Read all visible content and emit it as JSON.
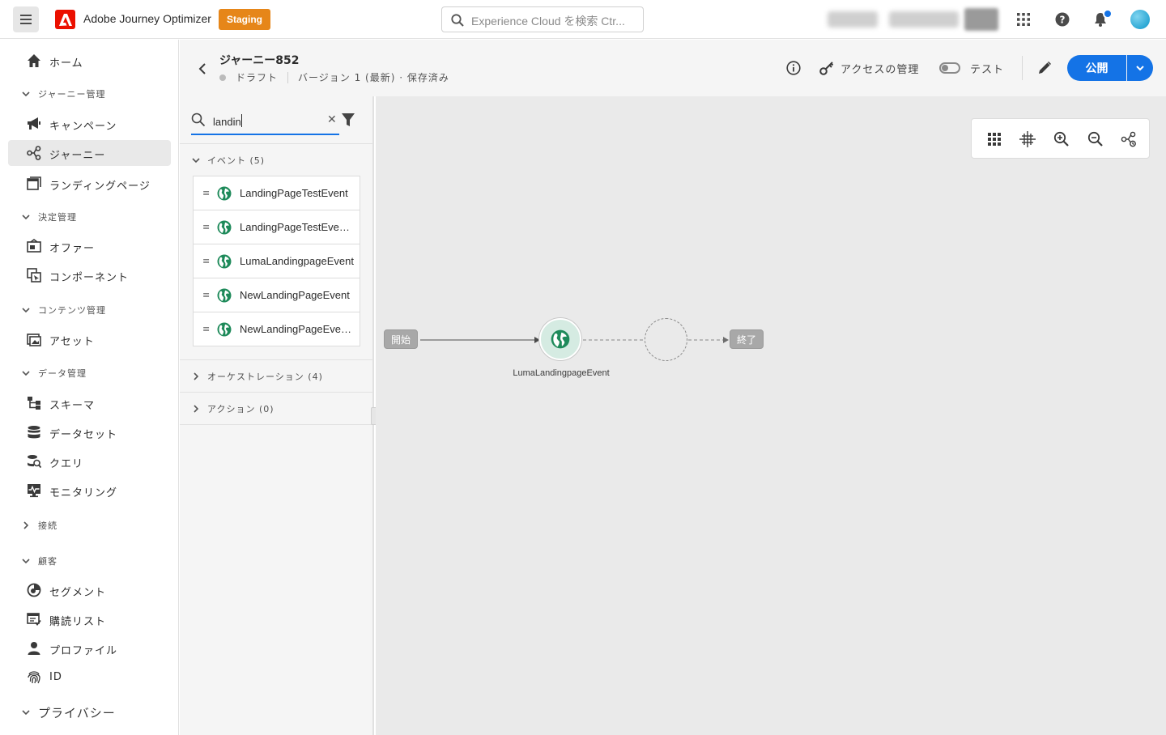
{
  "topbar": {
    "app_name": "Adobe Journey Optimizer",
    "environment": "Staging",
    "search_placeholder": "Experience Cloud を検索 Ctr..."
  },
  "nav": {
    "home": "ホーム",
    "sections": {
      "journey_mgmt": "ジャーニー管理",
      "decision_mgmt": "決定管理",
      "content_mgmt": "コンテンツ管理",
      "data_mgmt": "データ管理",
      "connections": "接続",
      "customers": "顧客",
      "privacy": "プライバシー"
    },
    "items": {
      "campaigns": "キャンペーン",
      "journeys": "ジャーニー",
      "landing_pages": "ランディングページ",
      "offers": "オファー",
      "components": "コンポーネント",
      "assets": "アセット",
      "schemas": "スキーマ",
      "datasets": "データセット",
      "queries": "クエリ",
      "monitoring": "モニタリング",
      "segments": "セグメント",
      "subscription_lists": "購読リスト",
      "profiles": "プロファイル",
      "identities": "ID"
    }
  },
  "journey": {
    "title": "ジャーニー852",
    "status": "ドラフト",
    "version": "バージョン 1 (最新) · 保存済み",
    "manage_access": "アクセスの管理",
    "test_label": "テスト",
    "publish": "公開"
  },
  "palette": {
    "search_value": "landin",
    "categories": {
      "events": "イベント (5)",
      "orchestration": "オーケストレーション (4)",
      "actions": "アクション (0)"
    },
    "events": [
      {
        "label": "LandingPageTestEvent"
      },
      {
        "label": "LandingPageTestEvent..."
      },
      {
        "label": "LumaLandingpageEvent"
      },
      {
        "label": "NewLandingPageEvent"
      },
      {
        "label": "NewLandingPageEven..."
      }
    ]
  },
  "canvas": {
    "start": "開始",
    "end": "終了",
    "event_node_label": "LumaLandingpageEvent"
  },
  "colors": {
    "accent": "#1473e6",
    "staging": "#e68619",
    "event_icon": "#1e8a5a",
    "adobe_red": "#eb1000"
  },
  "icons": {
    "event": "globe-icon",
    "search": "search-icon",
    "filter": "filter-icon"
  }
}
